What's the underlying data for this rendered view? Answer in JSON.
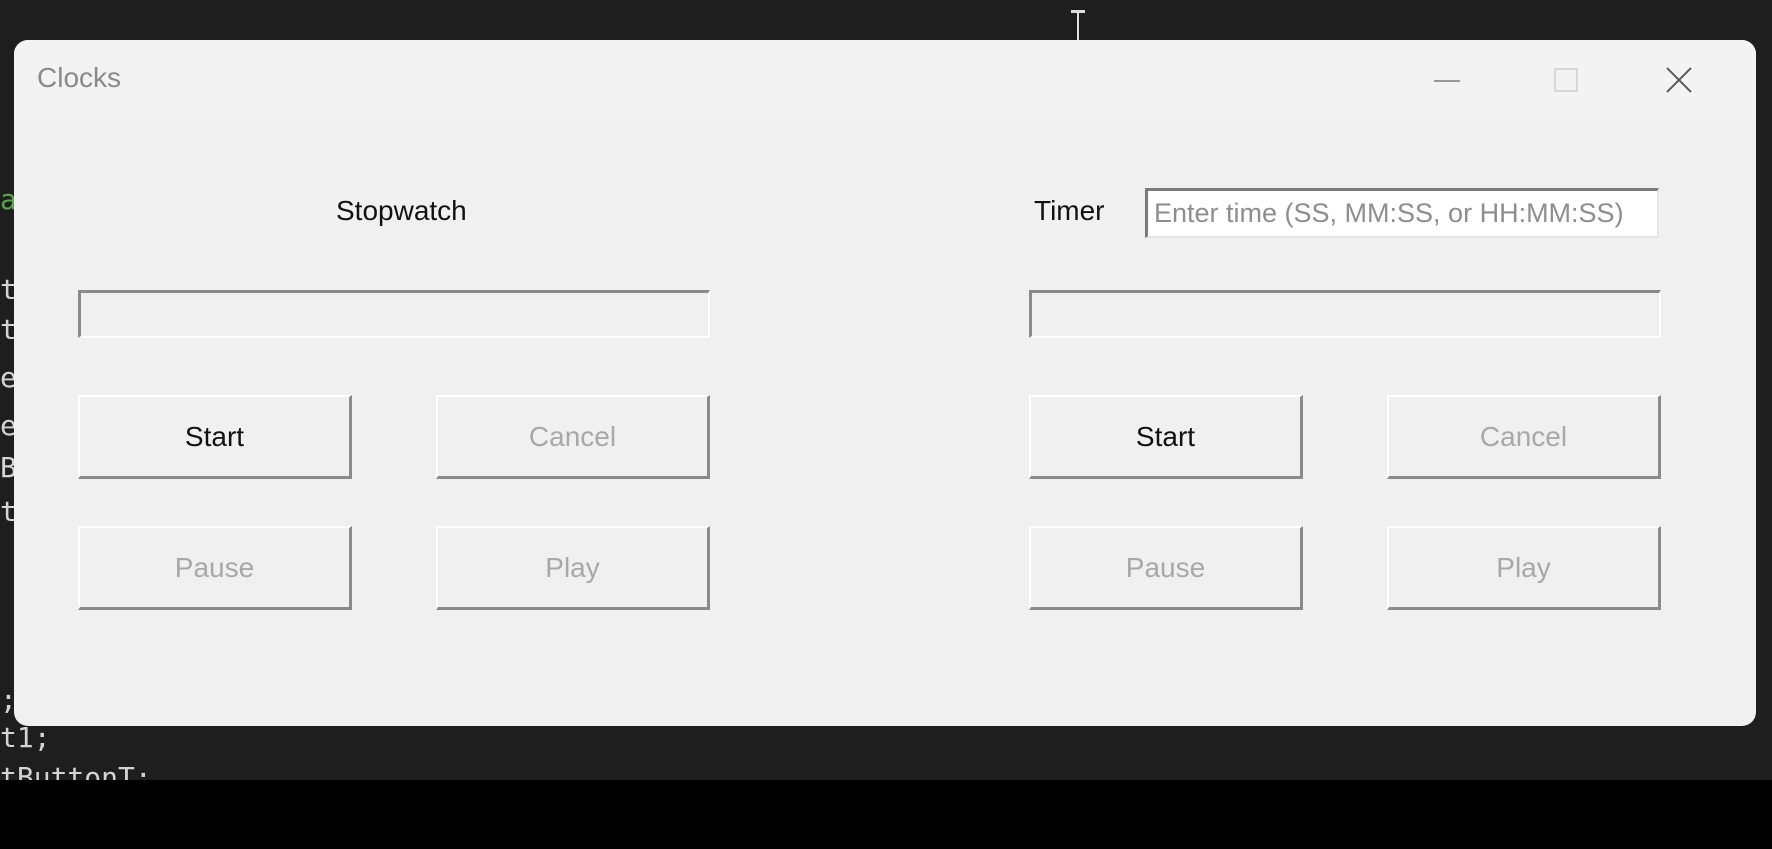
{
  "window": {
    "title": "Clocks"
  },
  "stopwatch": {
    "label": "Stopwatch",
    "display_value": "",
    "buttons": {
      "start": "Start",
      "cancel": "Cancel",
      "pause": "Pause",
      "play": "Play"
    }
  },
  "timer": {
    "label": "Timer",
    "input_placeholder": "Enter time (SS, MM:SS, or HH:MM:SS)",
    "display_value": "",
    "buttons": {
      "start": "Start",
      "cancel": "Cancel",
      "pause": "Pause",
      "play": "Play"
    }
  },
  "background_code": {
    "fragments": [
      "a",
      "t",
      "t",
      "e",
      "e",
      "B",
      "t",
      ";",
      "t1;",
      "tButtonT;"
    ]
  }
}
